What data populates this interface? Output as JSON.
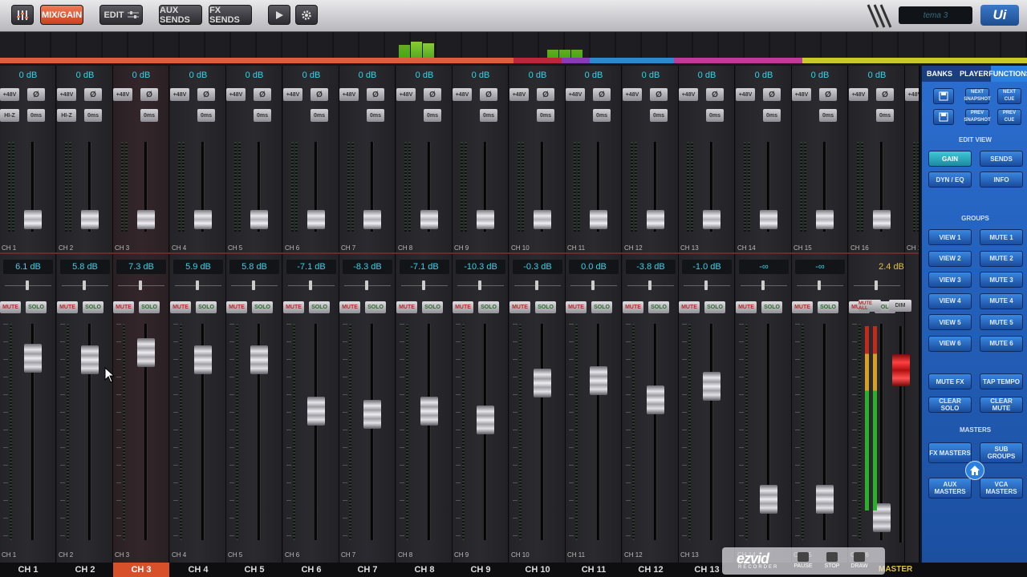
{
  "topbar": {
    "buttons": [
      {
        "id": "mixer-icon",
        "label": ""
      },
      {
        "id": "mixgain",
        "label": "MIX/GAIN"
      },
      {
        "id": "edit",
        "label": "EDIT"
      },
      {
        "id": "auxsends",
        "label": "AUX SENDS"
      },
      {
        "id": "fxsends",
        "label": "FX SENDS"
      }
    ],
    "play_icon": "play-icon",
    "settings_icon": "gear-icon",
    "preset": "tema 3",
    "logo": "Ui"
  },
  "channels": [
    {
      "name": "CH 1",
      "gain": "0 dB",
      "level": "6.1 dB",
      "fader": 0.85
    },
    {
      "name": "CH 2",
      "gain": "0 dB",
      "level": "5.8 dB",
      "fader": 0.84
    },
    {
      "name": "CH 3",
      "gain": "0 dB",
      "level": "7.3 dB",
      "fader": 0.88
    },
    {
      "name": "CH 4",
      "gain": "0 dB",
      "level": "5.9 dB",
      "fader": 0.84
    },
    {
      "name": "CH 5",
      "gain": "0 dB",
      "level": "5.8 dB",
      "fader": 0.84
    },
    {
      "name": "CH 6",
      "gain": "0 dB",
      "level": "-7.1 dB",
      "fader": 0.57
    },
    {
      "name": "CH 7",
      "gain": "0 dB",
      "level": "-8.3 dB",
      "fader": 0.55
    },
    {
      "name": "CH 8",
      "gain": "0 dB",
      "level": "-7.1 dB",
      "fader": 0.57
    },
    {
      "name": "CH 9",
      "gain": "0 dB",
      "level": "-10.3 dB",
      "fader": 0.52
    },
    {
      "name": "CH 10",
      "gain": "0 dB",
      "level": "-0.3 dB",
      "fader": 0.72
    },
    {
      "name": "CH 11",
      "gain": "0 dB",
      "level": "0.0 dB",
      "fader": 0.73
    },
    {
      "name": "CH 12",
      "gain": "0 dB",
      "level": "-3.8 dB",
      "fader": 0.63
    },
    {
      "name": "CH 13",
      "gain": "0 dB",
      "level": "-1.0 dB",
      "fader": 0.7
    },
    {
      "name": "CH 14",
      "gain": "0 dB",
      "level": "-∞",
      "fader": 0.1
    },
    {
      "name": "CH 15",
      "gain": "0 dB",
      "level": "-∞",
      "fader": 0.1
    },
    {
      "name": "CH 16",
      "gain": "0 dB",
      "level": "",
      "fader": 0
    },
    {
      "name": "CH 1",
      "gain": "",
      "level": "",
      "fader": 0
    }
  ],
  "labels": {
    "p48": "+48V",
    "phase": "Ø",
    "hiz": "HI-Z",
    "delay": "0ms",
    "mute": "MUTE",
    "solo": "SOLO"
  },
  "master": {
    "level": "2.4 dB",
    "mute_all": "MUTE ALL",
    "dim": "DIM",
    "label": "MASTER",
    "fader": 0.78
  },
  "bottom_channels": [
    "CH 1",
    "CH 2",
    "CH 3",
    "CH 4",
    "CH 5",
    "CH 6",
    "CH 7",
    "CH 8",
    "CH 9",
    "CH 10",
    "CH 11",
    "CH 12",
    "CH 13"
  ],
  "bottom_master": "MASTER",
  "recorder": {
    "logo": "ezvid",
    "sub": "RECORDER",
    "pause": "PAUSE",
    "stop": "STOP",
    "draw": "DRAW"
  },
  "panel": {
    "tabs": [
      "BANKS",
      "PLAYER",
      "FUNCTIONS"
    ],
    "snap": {
      "next_snapshot": "NEXT SNAPSHOT",
      "next_cue": "NEXT CUE",
      "prev_snapshot": "PREV SNAPSHOT",
      "prev_cue": "PREV CUE"
    },
    "edit_view_title": "EDIT VIEW",
    "edit_view": [
      "GAIN",
      "SENDS",
      "DYN / EQ",
      "INFO"
    ],
    "groups_title": "GROUPS",
    "views": [
      "VIEW 1",
      "VIEW 2",
      "VIEW 3",
      "VIEW 4",
      "VIEW 5",
      "VIEW 6"
    ],
    "mutes": [
      "MUTE 1",
      "MUTE 2",
      "MUTE 3",
      "MUTE 4",
      "MUTE 5",
      "MUTE 6"
    ],
    "actions": [
      "MUTE FX",
      "TAP TEMPO",
      "CLEAR SOLO",
      "CLEAR MUTE"
    ],
    "masters_title": "MASTERS",
    "masters": [
      "FX MASTERS",
      "SUB GROUPS",
      "AUX MASTERS",
      "VCA MASTERS"
    ]
  }
}
